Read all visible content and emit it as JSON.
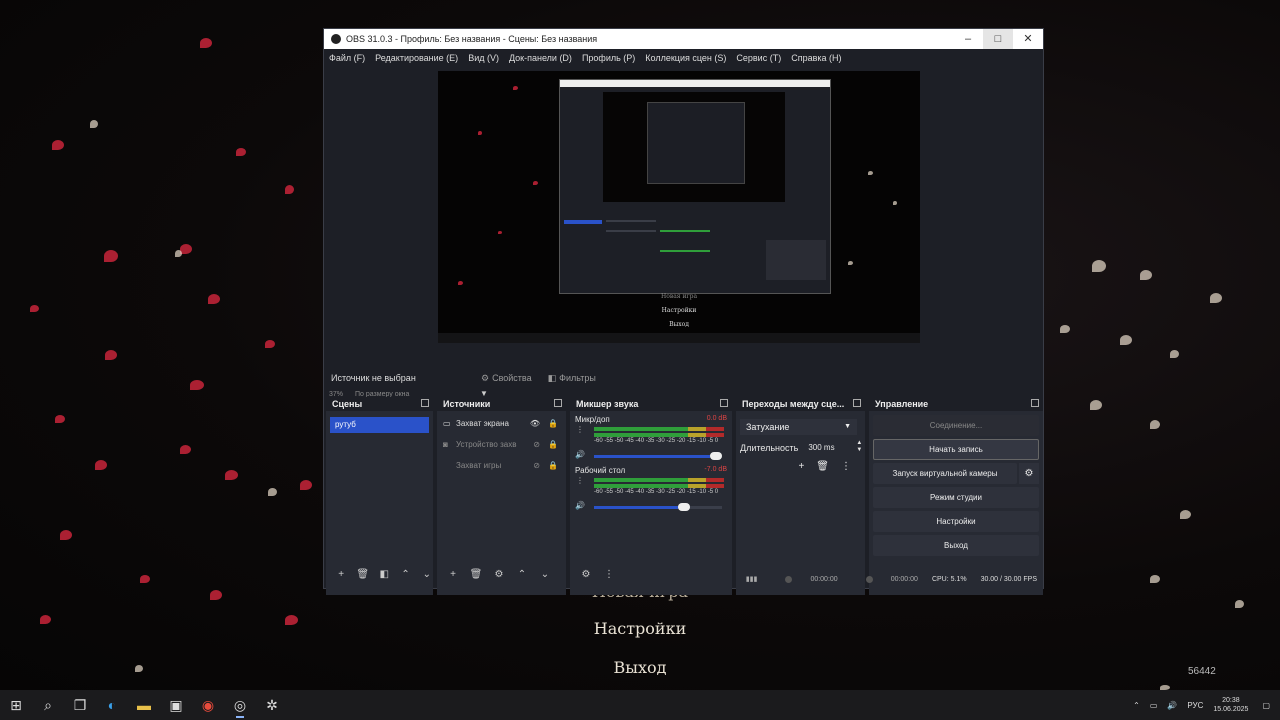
{
  "window": {
    "title": "OBS 31.0.3 - Профиль: Без названия - Сцены: Без названия",
    "minimize_icon": "–",
    "maximize_icon": "□",
    "close_icon": "✕"
  },
  "menu": [
    "Файл (F)",
    "Редактирование (E)",
    "Вид (V)",
    "Док-панели (D)",
    "Профиль (P)",
    "Коллекция сцен (S)",
    "Сервис (T)",
    "Справка (H)"
  ],
  "preview": {
    "zoom": "37%",
    "zoom_mode": "По размеру окна",
    "inner_menu": [
      "Новая игра",
      "Настройки",
      "Выход"
    ]
  },
  "source_bar": {
    "no_source": "Источник не выбран",
    "properties": "Свойства",
    "filters": "Фильтры"
  },
  "scenes": {
    "title": "Сцены",
    "items": [
      "рутуб"
    ]
  },
  "sources": {
    "title": "Источники",
    "items": [
      {
        "name": "Захват экрана",
        "icon": "monitor-icon",
        "visible": true
      },
      {
        "name": "Устройство захв",
        "icon": "camera-icon",
        "visible": false
      },
      {
        "name": "Захват игры",
        "icon": "gamepad-icon",
        "visible": false
      }
    ]
  },
  "mixer": {
    "title": "Микшер звука",
    "ticks": "-60 -55 -50 -45 -40 -35 -30 -25 -20 -15 -10 -5 0",
    "channels": [
      {
        "name": "Микр/доп",
        "db": "0.0 dB",
        "level": 1.0
      },
      {
        "name": "Рабочий стол",
        "db": "-7.0 dB",
        "level": 0.72
      }
    ]
  },
  "transitions": {
    "title": "Переходы между сце...",
    "selected": "Затухание",
    "duration_label": "Длительность",
    "duration_value": "300 ms"
  },
  "controls": {
    "title": "Управление",
    "connecting": "Соединение...",
    "start_recording": "Начать запись",
    "virtual_camera": "Запуск виртуальной камеры",
    "studio_mode": "Режим студии",
    "settings": "Настройки",
    "exit": "Выход"
  },
  "status": {
    "stream_time": "00:00:00",
    "rec_time": "00:00:00",
    "cpu": "CPU: 5.1%",
    "fps": "30.00 / 30.00 FPS"
  },
  "desktop": {
    "menu": [
      "Новая игра",
      "Настройки",
      "Выход"
    ],
    "counter": "56442"
  },
  "taskbar": {
    "lang": "РУС",
    "time": "20:38",
    "date": "15.06.2025"
  }
}
